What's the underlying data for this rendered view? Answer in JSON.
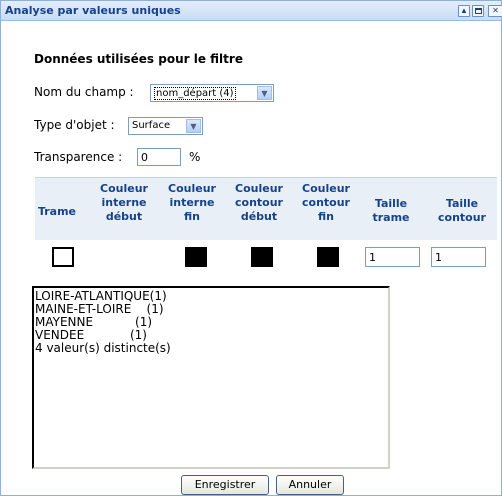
{
  "window": {
    "title": "Analyse par valeurs uniques",
    "buttons": {
      "collapse_icon": "triangle-up",
      "maximize_icon": "square",
      "close_icon": "close-x"
    }
  },
  "form": {
    "section_title": "Données utilisées pour le filtre",
    "field_name_label": "Nom du champ :",
    "field_name_value": "nom_départ (4)",
    "object_type_label": "Type d'objet :",
    "object_type_value": "Surface",
    "transparency_label": "Transparence :",
    "transparency_value": "0",
    "transparency_unit": "%"
  },
  "grid": {
    "headers": {
      "trame": "Trame",
      "couleur_interne_debut": "Couleur\ninterne\ndébut",
      "couleur_interne_fin": "Couleur\ninterne\nfin",
      "couleur_contour_debut": "Couleur\ncontour\ndébut",
      "couleur_contour_fin": "Couleur\ncontour\nfin",
      "taille_trame": "Taille\ntrame",
      "taille_contour": "Taille\ncontour"
    },
    "row": {
      "trame_color": "#ffffff",
      "couleur_interne_debut": "#ffffff",
      "couleur_interne_fin": "#000000",
      "couleur_contour_debut": "#000000",
      "couleur_contour_fin": "#000000",
      "taille_trame": "1",
      "taille_contour": "1"
    }
  },
  "values_list": {
    "lines": [
      "LOIRE-ATLANTIQUE(1)",
      "MAINE-ET-LOIRE    (1)",
      "MAYENNE           (1)",
      "VENDEE            (1)",
      "4 valeur(s) distincte(s)"
    ]
  },
  "footer": {
    "save_label": "Enregistrer",
    "cancel_label": "Annuler"
  },
  "colors": {
    "title_text": "#15428b",
    "header_bg": "#e9eff7",
    "border_blue": "#7f9db9"
  }
}
